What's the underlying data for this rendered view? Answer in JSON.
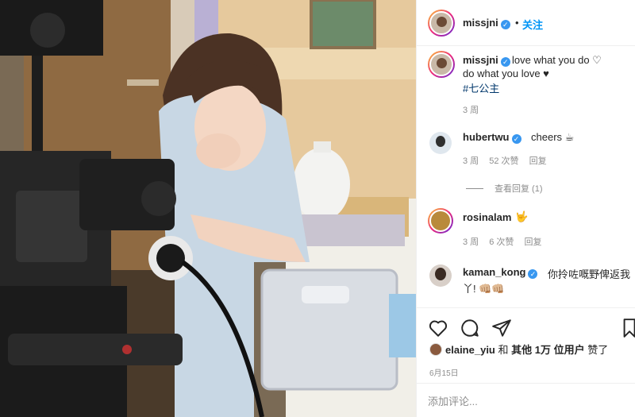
{
  "post": {
    "author": "missjni",
    "header_separator": "•",
    "follow_label": "关注",
    "verified_icon": "verified-badge-icon",
    "caption_line1": "love what you do ♡",
    "caption_line2": "do what you love ♥",
    "caption_hashtag": "#七公主",
    "caption_time": "3 周"
  },
  "comments": [
    {
      "user": "hubertwu",
      "verified": true,
      "text": "cheers ☕",
      "time": "3 周",
      "likes": "52 次赞",
      "reply": "回复"
    },
    {
      "user": "rosinalam",
      "verified": false,
      "text": "🤟",
      "time": "3 周",
      "likes": "6 次赞",
      "reply": "回复"
    },
    {
      "user": "kaman_kong",
      "verified": true,
      "text_line1": "你拎咗嘅野俾返我",
      "text_line2": "丫! 👊🏼👊🏼"
    }
  ],
  "view_replies": "查看回复 (1)",
  "actions": {
    "icons": [
      "heart-icon",
      "comment-icon",
      "share-icon",
      "bookmark-icon"
    ]
  },
  "likes_line": {
    "user": "elaine_yiu",
    "and": "和",
    "others": "其他 1万 位用户",
    "suffix": "赞了"
  },
  "date": "6月15日",
  "add_comment_placeholder": "添加评论...",
  "colors": {
    "link_blue": "#0095f6",
    "verified_blue": "#3897f0",
    "muted": "#8e8e8e"
  }
}
